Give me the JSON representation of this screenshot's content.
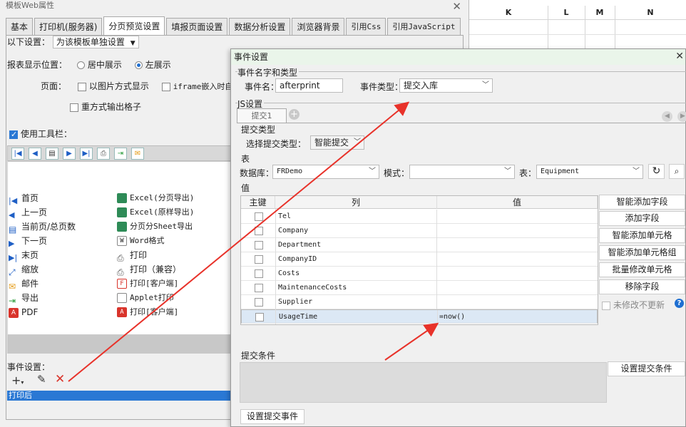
{
  "sheet": {
    "columns": [
      "K",
      "L",
      "M",
      "N"
    ]
  },
  "left_window": {
    "title": "模板Web属性",
    "tabs": [
      "基本",
      "打印机(服务器)",
      "分页预览设置",
      "填报页面设置",
      "数据分析设置",
      "浏览器背景",
      "引用Css",
      "引用JavaScript"
    ],
    "active_tab": 2,
    "settings_label": "以下设置：",
    "settings_value": "为该模板单独设置",
    "position_label": "报表显示位置：",
    "position_center": "居中展示",
    "position_left": "左展示",
    "page_label": "页面：",
    "opt_image": "以图片方式显示",
    "opt_iframe": "iframe嵌入时自动",
    "opt_repeat": "重方式输出格子",
    "use_toolbar": "使用工具栏：",
    "list_left": [
      "首页",
      "上一页",
      "当前页/总页数",
      "下一页",
      "末页",
      "缩放",
      "邮件",
      "导出",
      "PDF"
    ],
    "list_right": [
      "Excel(分页导出)",
      "Excel(原样导出)",
      "分页分Sheet导出",
      "Word格式",
      "打印",
      "打印（兼容）",
      "打印[客户端]",
      "Applet打印",
      "打印[客户端]"
    ],
    "event_label": "事件设置：",
    "event_item": "打印后"
  },
  "dialog": {
    "title": "事件设置",
    "group_name_type": "事件名字和类型",
    "event_name_label": "事件名：",
    "event_name_value": "afterprint",
    "event_type_label": "事件类型：",
    "event_type_value": "提交入库",
    "js_group": "JS设置",
    "subtab": "提交1",
    "submit_type_group": "提交类型",
    "choose_type_label": "选择提交类型：",
    "choose_type_value": "智能提交",
    "table_group": "表",
    "db_label": "数据库：",
    "db_value": "FRDemo",
    "mode_label": "模式：",
    "mode_value": "",
    "table_label": "表：",
    "table_value": "Equipment",
    "value_group": "值",
    "col_key": "主键",
    "col_column": "列",
    "col_value": "值",
    "rows": [
      {
        "column": "Tel",
        "value": ""
      },
      {
        "column": "Company",
        "value": ""
      },
      {
        "column": "Department",
        "value": ""
      },
      {
        "column": "CompanyID",
        "value": ""
      },
      {
        "column": "Costs",
        "value": ""
      },
      {
        "column": "MaintenanceCosts",
        "value": ""
      },
      {
        "column": "Supplier",
        "value": ""
      },
      {
        "column": "UsageTime",
        "value": "=now()"
      }
    ],
    "side_buttons": [
      "智能添加字段",
      "添加字段",
      "智能添加单元格",
      "智能添加单元格组",
      "批量修改单元格",
      "移除字段"
    ],
    "no_modify_label": "未修改不更新",
    "condition_group": "提交条件",
    "set_condition_button": "设置提交条件",
    "set_event_button": "设置提交事件"
  },
  "colors": {
    "accent": "#1f6fd1",
    "arrow": "#e8322a",
    "dialog_title_bg": "#eaf5ea"
  }
}
